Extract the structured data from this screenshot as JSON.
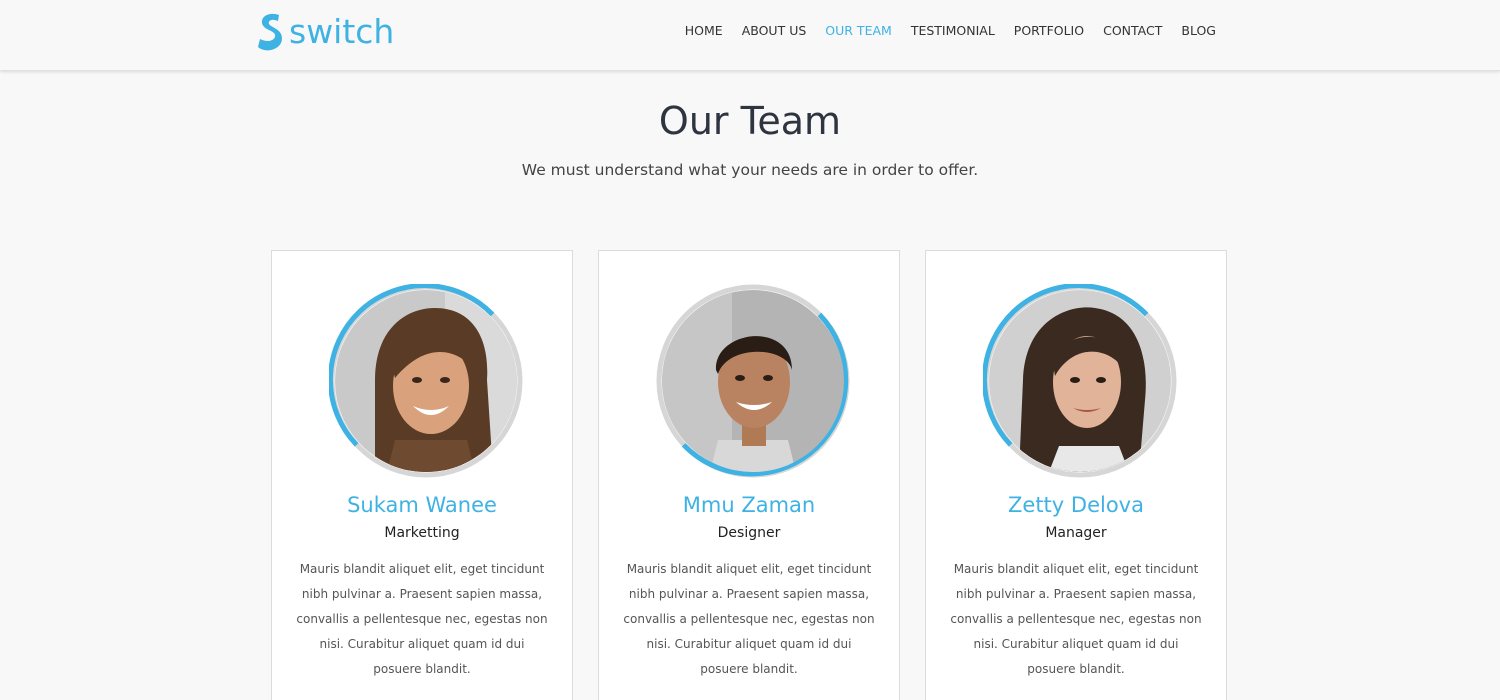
{
  "header": {
    "logo_text": "switch",
    "nav": [
      {
        "label": "HOME",
        "active": false
      },
      {
        "label": "ABOUT US",
        "active": false
      },
      {
        "label": "OUR TEAM",
        "active": true
      },
      {
        "label": "TESTIMONIAL",
        "active": false
      },
      {
        "label": "PORTFOLIO",
        "active": false
      },
      {
        "label": "CONTACT",
        "active": false
      },
      {
        "label": "BLOG",
        "active": false
      }
    ]
  },
  "section": {
    "title": "Our Team",
    "subtitle": "We must understand what your needs are in order to offer."
  },
  "team": [
    {
      "name": "Sukam Wanee",
      "role": "Marketting",
      "bio": "Mauris blandit aliquet elit, eget tincidunt nibh pulvinar a. Praesent sapien massa, convallis a pellentesque nec, egestas non nisi. Curabitur aliquet quam id dui posuere blandit.",
      "photo": "woman-smiling-long-brown-hair-photo"
    },
    {
      "name": "Mmu Zaman",
      "role": "Designer",
      "bio": "Mauris blandit aliquet elit, eget tincidunt nibh pulvinar a. Praesent sapien massa, convallis a pellentesque nec, egestas non nisi. Curabitur aliquet quam id dui posuere blandit.",
      "photo": "man-smiling-short-dark-hair-photo"
    },
    {
      "name": "Zetty Delova",
      "role": "Manager",
      "bio": "Mauris blandit aliquet elit, eget tincidunt nibh pulvinar a. Praesent sapien massa, convallis a pellentesque nec, egestas non nisi. Curabitur aliquet quam id dui posuere blandit.",
      "photo": "woman-curly-dark-hair-photo"
    }
  ],
  "colors": {
    "accent": "#3db2e3",
    "heading": "#2e3440",
    "background": "#f8f8f8",
    "card_border": "#dcdcdc",
    "ring_gray": "#d6d6d6"
  }
}
